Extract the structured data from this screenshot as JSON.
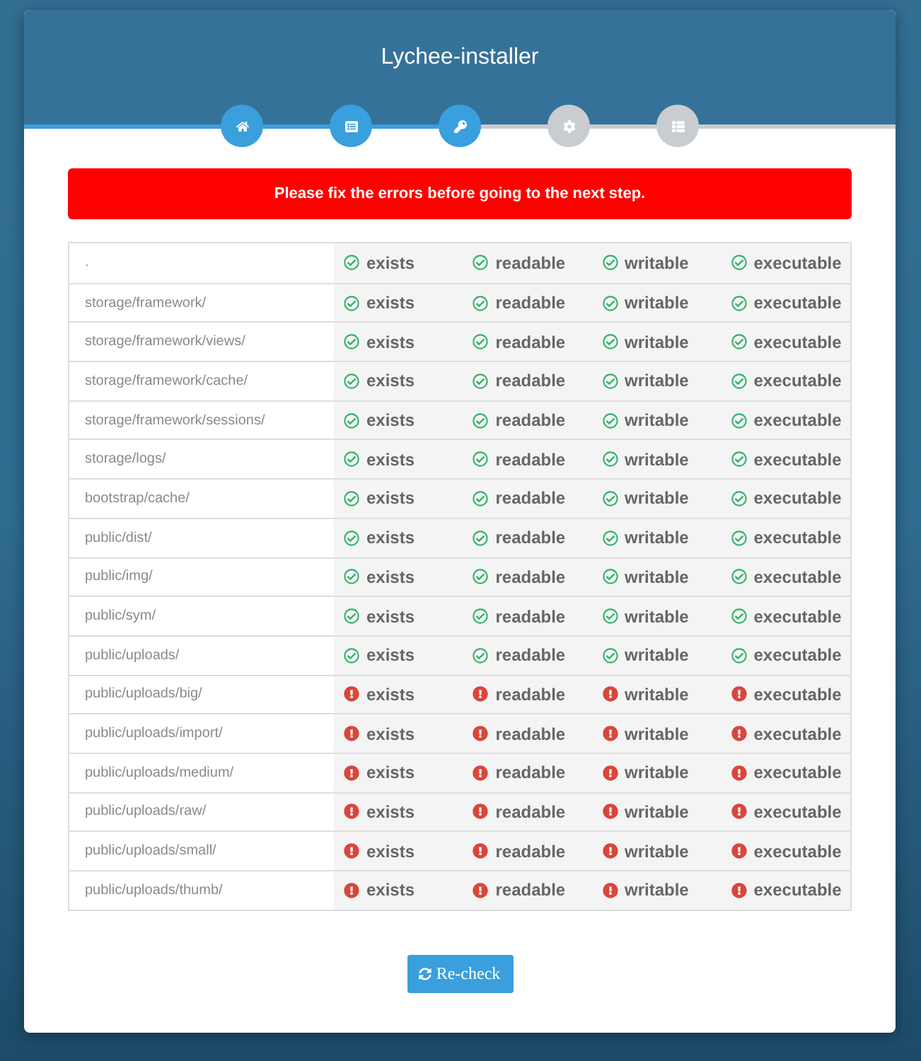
{
  "window": {
    "title": "Lychee-installer"
  },
  "steps": [
    {
      "completed": true
    },
    {
      "completed": true
    },
    {
      "completed": true
    },
    {
      "completed": false
    },
    {
      "completed": false
    }
  ],
  "alert": {
    "message": "Please fix the errors before going to the next step."
  },
  "table": {
    "rows": [
      {
        "path": ".",
        "checks": [
          {
            "label": "exists",
            "ok": true
          },
          {
            "label": "readable",
            "ok": true
          },
          {
            "label": "writable",
            "ok": true
          },
          {
            "label": "executable",
            "ok": true
          }
        ]
      },
      {
        "path": "storage/framework/",
        "checks": [
          {
            "label": "exists",
            "ok": true
          },
          {
            "label": "readable",
            "ok": true
          },
          {
            "label": "writable",
            "ok": true
          },
          {
            "label": "executable",
            "ok": true
          }
        ]
      },
      {
        "path": "storage/framework/views/",
        "checks": [
          {
            "label": "exists",
            "ok": true
          },
          {
            "label": "readable",
            "ok": true
          },
          {
            "label": "writable",
            "ok": true
          },
          {
            "label": "executable",
            "ok": true
          }
        ]
      },
      {
        "path": "storage/framework/cache/",
        "checks": [
          {
            "label": "exists",
            "ok": true
          },
          {
            "label": "readable",
            "ok": true
          },
          {
            "label": "writable",
            "ok": true
          },
          {
            "label": "executable",
            "ok": true
          }
        ]
      },
      {
        "path": "storage/framework/sessions/",
        "checks": [
          {
            "label": "exists",
            "ok": true
          },
          {
            "label": "readable",
            "ok": true
          },
          {
            "label": "writable",
            "ok": true
          },
          {
            "label": "executable",
            "ok": true
          }
        ]
      },
      {
        "path": "storage/logs/",
        "checks": [
          {
            "label": "exists",
            "ok": true
          },
          {
            "label": "readable",
            "ok": true
          },
          {
            "label": "writable",
            "ok": true
          },
          {
            "label": "executable",
            "ok": true
          }
        ]
      },
      {
        "path": "bootstrap/cache/",
        "checks": [
          {
            "label": "exists",
            "ok": true
          },
          {
            "label": "readable",
            "ok": true
          },
          {
            "label": "writable",
            "ok": true
          },
          {
            "label": "executable",
            "ok": true
          }
        ]
      },
      {
        "path": "public/dist/",
        "checks": [
          {
            "label": "exists",
            "ok": true
          },
          {
            "label": "readable",
            "ok": true
          },
          {
            "label": "writable",
            "ok": true
          },
          {
            "label": "executable",
            "ok": true
          }
        ]
      },
      {
        "path": "public/img/",
        "checks": [
          {
            "label": "exists",
            "ok": true
          },
          {
            "label": "readable",
            "ok": true
          },
          {
            "label": "writable",
            "ok": true
          },
          {
            "label": "executable",
            "ok": true
          }
        ]
      },
      {
        "path": "public/sym/",
        "checks": [
          {
            "label": "exists",
            "ok": true
          },
          {
            "label": "readable",
            "ok": true
          },
          {
            "label": "writable",
            "ok": true
          },
          {
            "label": "executable",
            "ok": true
          }
        ]
      },
      {
        "path": "public/uploads/",
        "checks": [
          {
            "label": "exists",
            "ok": true
          },
          {
            "label": "readable",
            "ok": true
          },
          {
            "label": "writable",
            "ok": true
          },
          {
            "label": "executable",
            "ok": true
          }
        ]
      },
      {
        "path": "public/uploads/big/",
        "checks": [
          {
            "label": "exists",
            "ok": false
          },
          {
            "label": "readable",
            "ok": false
          },
          {
            "label": "writable",
            "ok": false
          },
          {
            "label": "executable",
            "ok": false
          }
        ]
      },
      {
        "path": "public/uploads/import/",
        "checks": [
          {
            "label": "exists",
            "ok": false
          },
          {
            "label": "readable",
            "ok": false
          },
          {
            "label": "writable",
            "ok": false
          },
          {
            "label": "executable",
            "ok": false
          }
        ]
      },
      {
        "path": "public/uploads/medium/",
        "checks": [
          {
            "label": "exists",
            "ok": false
          },
          {
            "label": "readable",
            "ok": false
          },
          {
            "label": "writable",
            "ok": false
          },
          {
            "label": "executable",
            "ok": false
          }
        ]
      },
      {
        "path": "public/uploads/raw/",
        "checks": [
          {
            "label": "exists",
            "ok": false
          },
          {
            "label": "readable",
            "ok": false
          },
          {
            "label": "writable",
            "ok": false
          },
          {
            "label": "executable",
            "ok": false
          }
        ]
      },
      {
        "path": "public/uploads/small/",
        "checks": [
          {
            "label": "exists",
            "ok": false
          },
          {
            "label": "readable",
            "ok": false
          },
          {
            "label": "writable",
            "ok": false
          },
          {
            "label": "executable",
            "ok": false
          }
        ]
      },
      {
        "path": "public/uploads/thumb/",
        "checks": [
          {
            "label": "exists",
            "ok": false
          },
          {
            "label": "readable",
            "ok": false
          },
          {
            "label": "writable",
            "ok": false
          },
          {
            "label": "executable",
            "ok": false
          }
        ]
      }
    ]
  },
  "recheck_button": {
    "label": "Re-check"
  }
}
